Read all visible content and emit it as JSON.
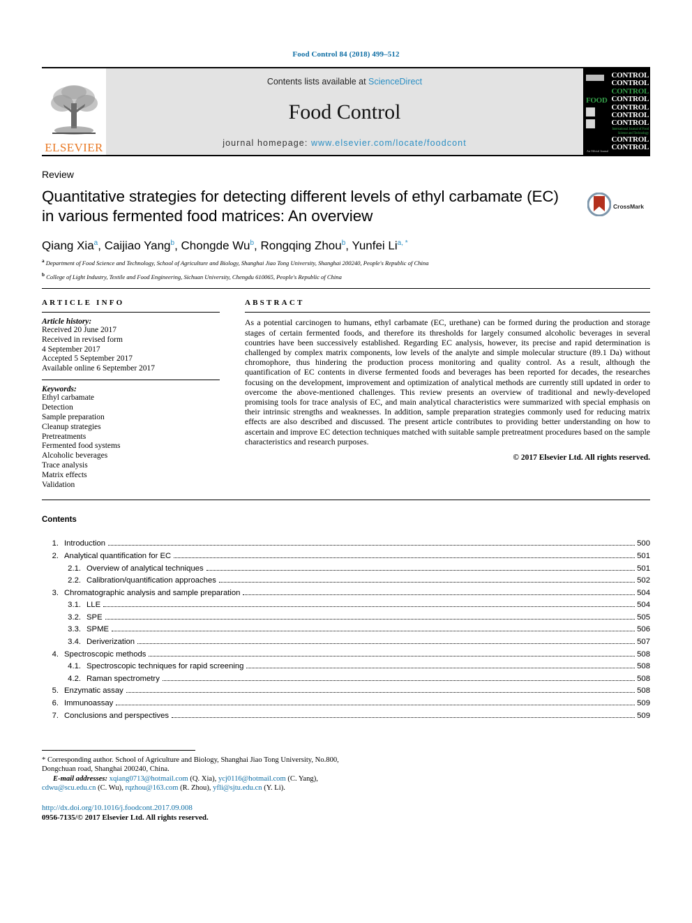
{
  "running_head": "Food Control 84 (2018) 499–512",
  "masthead": {
    "publisher_name": "ELSEVIER",
    "contents_prefix": "Contents lists available at ",
    "contents_link": "ScienceDirect",
    "journal_title": "Food Control",
    "homepage_prefix": "journal homepage: ",
    "homepage_url": "www.elsevier.com/locate/foodcont",
    "cover": {
      "food_word": "FOOD",
      "control_lines": [
        "CONTROL",
        "CONTROL",
        "CONTROL",
        "CONTROL",
        "CONTROL",
        "CONTROL",
        "CONTROL",
        "CONTROL",
        "CONTROL"
      ],
      "green_line_index": 2,
      "tagline": "International Journal of Food Science and Technology",
      "footer": "An Official Journal"
    }
  },
  "article": {
    "type": "Review",
    "title": "Quantitative strategies for detecting different levels of ethyl carbamate (EC) in various fermented food matrices: An overview",
    "crossmark_label": "CrossMark",
    "authors": [
      {
        "name": "Qiang Xia",
        "sup": "a"
      },
      {
        "name": "Caijiao Yang",
        "sup": "b"
      },
      {
        "name": "Chongde Wu",
        "sup": "b"
      },
      {
        "name": "Rongqing Zhou",
        "sup": "b"
      },
      {
        "name": "Yunfei Li",
        "sup": "a, *"
      }
    ],
    "affiliations": [
      {
        "mark": "a",
        "text": "Department of Food Science and Technology, School of Agriculture and Biology, Shanghai Jiao Tong University, Shanghai 200240, People's Republic of China"
      },
      {
        "mark": "b",
        "text": "College of Light Industry, Textile and Food Engineering, Sichuan University, Chengdu 610065, People's Republic of China"
      }
    ]
  },
  "article_info": {
    "heading": "ARTICLE INFO",
    "history_label": "Article history:",
    "history": [
      "Received 20 June 2017",
      "Received in revised form",
      "4 September 2017",
      "Accepted 5 September 2017",
      "Available online 6 September 2017"
    ],
    "keywords_label": "Keywords:",
    "keywords": [
      "Ethyl carbamate",
      "Detection",
      "Sample preparation",
      "Cleanup strategies",
      "Pretreatments",
      "Fermented food systems",
      "Alcoholic beverages",
      "Trace analysis",
      "Matrix effects",
      "Validation"
    ]
  },
  "abstract": {
    "heading": "ABSTRACT",
    "body": "As a potential carcinogen to humans, ethyl carbamate (EC, urethane) can be formed during the production and storage stages of certain fermented foods, and therefore its thresholds for largely consumed alcoholic beverages in several countries have been successively established. Regarding EC analysis, however, its precise and rapid determination is challenged by complex matrix components, low levels of the analyte and simple molecular structure (89.1 Da) without chromophore, thus hindering the production process monitoring and quality control. As a result, although the quantification of EC contents in diverse fermented foods and beverages has been reported for decades, the researches focusing on the development, improvement and optimization of analytical methods are currently still updated in order to overcome the above-mentioned challenges. This review presents an overview of traditional and newly-developed promising tools for trace analysis of EC, and main analytical characteristics were summarized with special emphasis on their intrinsic strengths and weaknesses. In addition, sample preparation strategies commonly used for reducing matrix effects are also described and discussed. The present article contributes to providing better understanding on how to ascertain and improve EC detection techniques matched with suitable sample pretreatment procedures based on the sample characteristics and research purposes.",
    "copyright": "© 2017 Elsevier Ltd. All rights reserved."
  },
  "contents": {
    "heading": "Contents",
    "entries": [
      {
        "num": "1.",
        "label": "Introduction",
        "page": "500",
        "sub": false
      },
      {
        "num": "2.",
        "label": "Analytical quantification for EC",
        "page": "501",
        "sub": false
      },
      {
        "num": "2.1.",
        "label": "Overview of analytical techniques",
        "page": "501",
        "sub": true
      },
      {
        "num": "2.2.",
        "label": "Calibration/quantification approaches",
        "page": "502",
        "sub": true
      },
      {
        "num": "3.",
        "label": "Chromatographic analysis and sample preparation",
        "page": "504",
        "sub": false
      },
      {
        "num": "3.1.",
        "label": "LLE",
        "page": "504",
        "sub": true
      },
      {
        "num": "3.2.",
        "label": "SPE",
        "page": "505",
        "sub": true
      },
      {
        "num": "3.3.",
        "label": "SPME",
        "page": "506",
        "sub": true
      },
      {
        "num": "3.4.",
        "label": "Deriverization",
        "page": "507",
        "sub": true
      },
      {
        "num": "4.",
        "label": "Spectroscopic methods",
        "page": "508",
        "sub": false
      },
      {
        "num": "4.1.",
        "label": "Spectroscopic techniques for rapid screening",
        "page": "508",
        "sub": true
      },
      {
        "num": "4.2.",
        "label": "Raman spectrometry",
        "page": "508",
        "sub": true
      },
      {
        "num": "5.",
        "label": "Enzymatic assay",
        "page": "508",
        "sub": false
      },
      {
        "num": "6.",
        "label": "Immunoassay",
        "page": "509",
        "sub": false
      },
      {
        "num": "7.",
        "label": "Conclusions and perspectives",
        "page": "509",
        "sub": false
      }
    ]
  },
  "footnotes": {
    "corresponding": "* Corresponding author. School of Agriculture and Biology, Shanghai Jiao Tong University, No.800, Dongchuan road, Shanghai 200240, China.",
    "email_label": "E-mail addresses:",
    "emails": [
      {
        "address": "xqiang0713@hotmail.com",
        "owner": "(Q. Xia)"
      },
      {
        "address": "ycj0116@hotmail.com",
        "owner": "(C. Yang)"
      },
      {
        "address": "cdwu@scu.edu.cn",
        "owner": "(C. Wu)"
      },
      {
        "address": "rqzhou@163.com",
        "owner": "(R. Zhou)"
      },
      {
        "address": "yfli@sjtu.edu.cn",
        "owner": "(Y. Li)"
      }
    ],
    "doi": "http://dx.doi.org/10.1016/j.foodcont.2017.09.008",
    "issn_line": "0956-7135/© 2017 Elsevier Ltd. All rights reserved."
  },
  "colors": {
    "link_blue": "#0b6ca3",
    "masthead_link_blue": "#2b8fc4",
    "elsevier_orange": "#e87722",
    "cover_green": "#35a04a",
    "crossmark_red": "#b3301d"
  }
}
